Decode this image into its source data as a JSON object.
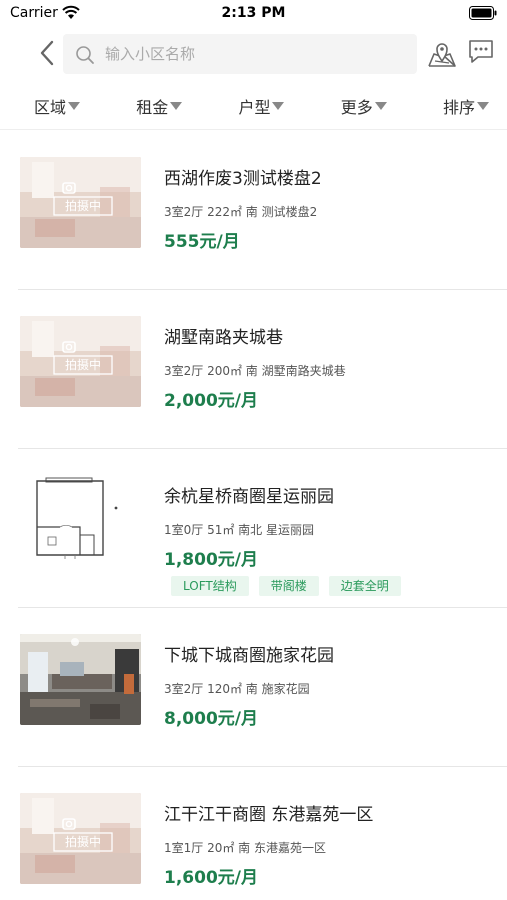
{
  "status": {
    "carrier": "Carrier",
    "time": "2:13 PM"
  },
  "search": {
    "placeholder": "输入小区名称",
    "value": ""
  },
  "filters": [
    {
      "label": "区域"
    },
    {
      "label": "租金"
    },
    {
      "label": "户型"
    },
    {
      "label": "更多"
    },
    {
      "label": "排序"
    }
  ],
  "listings": [
    {
      "title": "西湖作废3测试楼盘2",
      "meta": "3室2厅 222㎡ 南 测试楼盘2",
      "price": "555元/月",
      "image": "placeholder-photo",
      "badge": "拍摄中",
      "tags": []
    },
    {
      "title": "湖墅南路夹城巷",
      "meta": "3室2厅 200㎡ 南 湖墅南路夹城巷",
      "price": "2,000元/月",
      "image": "placeholder-photo",
      "badge": "拍摄中",
      "tags": []
    },
    {
      "title": "余杭星桥商圈星运丽园",
      "meta": "1室0厅 51㎡ 南北 星运丽园",
      "price": "1,800元/月",
      "image": "floorplan",
      "badge": "",
      "tags": [
        "LOFT结构",
        "带阁楼",
        "边套全明"
      ]
    },
    {
      "title": "下城下城商圈施家花园",
      "meta": "3室2厅 120㎡ 南 施家花园",
      "price": "8,000元/月",
      "image": "interior-photo",
      "badge": "",
      "tags": []
    },
    {
      "title": "江干江干商圈 东港嘉苑一区",
      "meta": "1室1厅 20㎡ 南 东港嘉苑一区",
      "price": "1,600元/月",
      "image": "placeholder-photo",
      "badge": "拍摄中",
      "tags": []
    }
  ],
  "colors": {
    "price": "#1e7e4d",
    "tag_bg": "#e9f6ee",
    "tag_text": "#2a9a5c"
  }
}
